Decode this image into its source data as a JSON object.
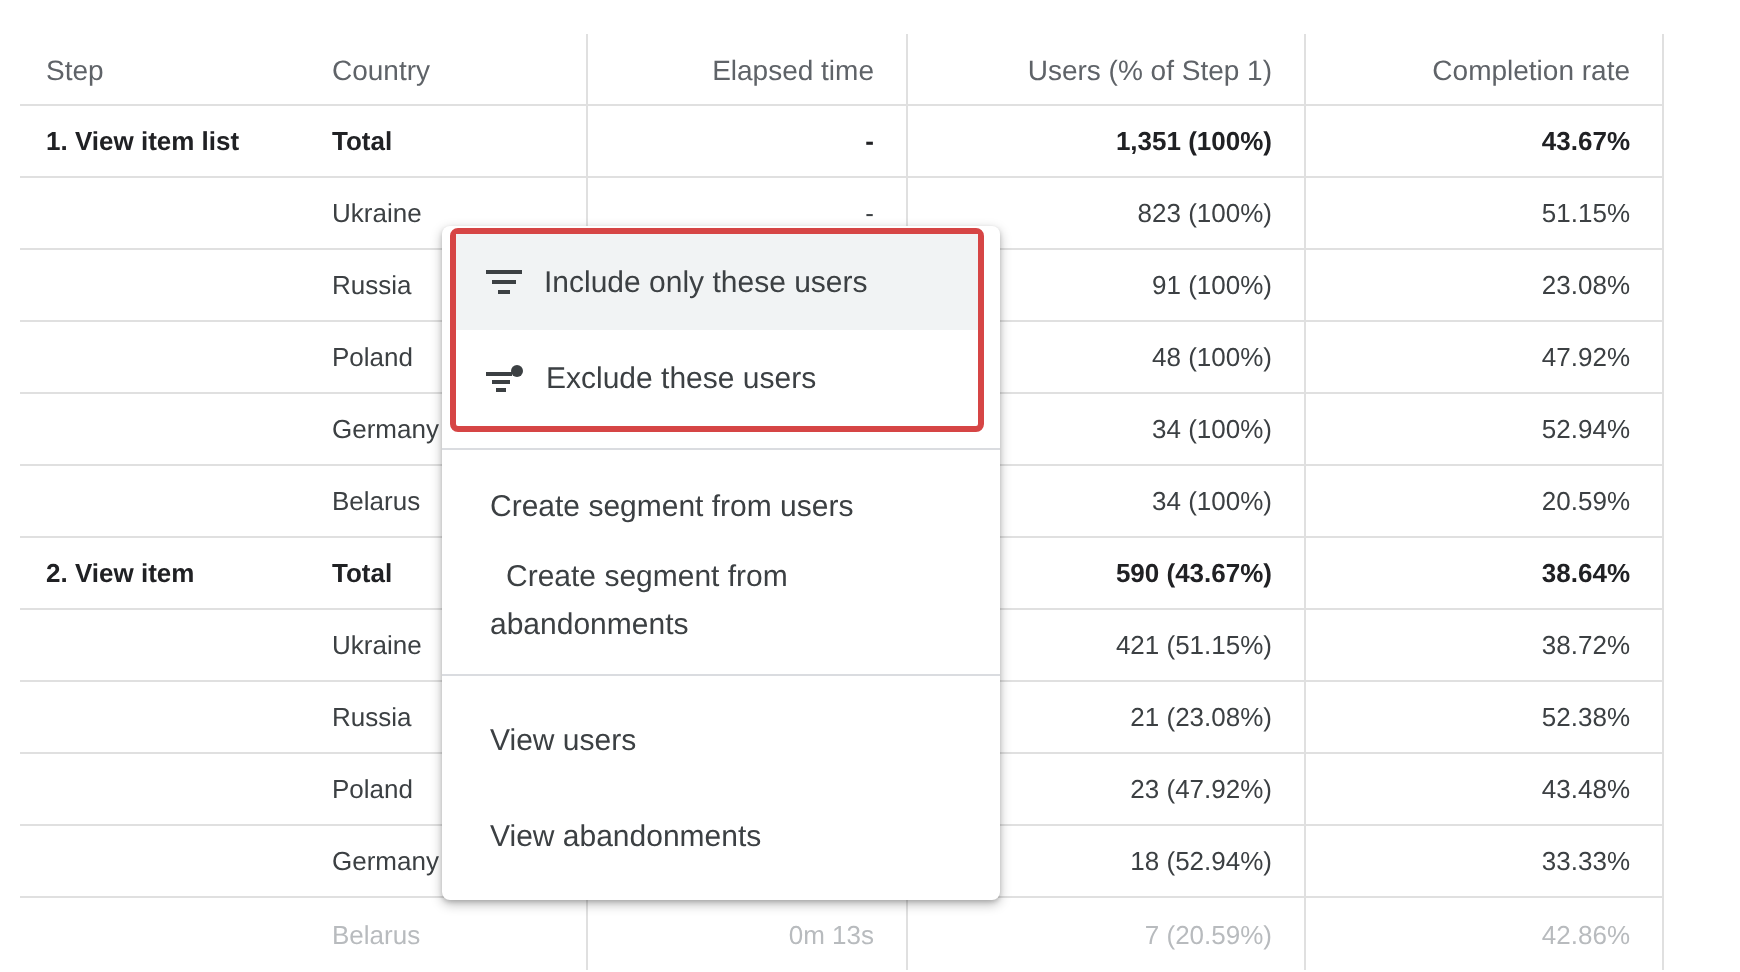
{
  "table": {
    "columns": [
      {
        "label": "Step"
      },
      {
        "label": "Country"
      },
      {
        "label": "Elapsed time"
      },
      {
        "label": "Users (% of Step 1)"
      },
      {
        "label": "Completion rate"
      }
    ],
    "rows": [
      {
        "kind": "total",
        "step": "1. View item list",
        "country": "Total",
        "elapsed": "-",
        "users": "1,351 (100%)",
        "completion": "43.67%"
      },
      {
        "kind": "country",
        "country": "Ukraine",
        "elapsed": "-",
        "users": "823 (100%)",
        "completion": "51.15%"
      },
      {
        "kind": "country",
        "country": "Russia",
        "users": "91 (100%)",
        "completion": "23.08%"
      },
      {
        "kind": "country",
        "country": "Poland",
        "users": "48 (100%)",
        "completion": "47.92%"
      },
      {
        "kind": "country",
        "country": "Germany",
        "users": "34 (100%)",
        "completion": "52.94%"
      },
      {
        "kind": "country",
        "country": "Belarus",
        "users": "34 (100%)",
        "completion": "20.59%"
      },
      {
        "kind": "total",
        "step": "2. View item",
        "country": "Total",
        "users": "590 (43.67%)",
        "completion": "38.64%"
      },
      {
        "kind": "country",
        "country": "Ukraine",
        "users": "421 (51.15%)",
        "completion": "38.72%"
      },
      {
        "kind": "country",
        "country": "Russia",
        "users": "21 (23.08%)",
        "completion": "52.38%"
      },
      {
        "kind": "country",
        "country": "Poland",
        "users": "23 (47.92%)",
        "completion": "43.48%"
      },
      {
        "kind": "country",
        "country": "Germany",
        "users": "18 (52.94%)",
        "completion": "33.33%"
      },
      {
        "kind": "country",
        "country": "Belarus",
        "elapsed": "0m 13s",
        "users": "7 (20.59%)",
        "completion": "42.86%"
      }
    ]
  },
  "context_menu": {
    "sections": [
      {
        "highlighted": true,
        "items": [
          {
            "kind": "include",
            "label": "Include only these users",
            "selected": true
          },
          {
            "kind": "exclude",
            "label": "Exclude these users",
            "selected": false
          }
        ]
      },
      {
        "highlighted": false,
        "items": [
          {
            "kind": "plain",
            "label": "Create segment from users",
            "selected": false
          },
          {
            "kind": "plain",
            "label": "Create segment from abandonments",
            "selected": false
          }
        ]
      },
      {
        "highlighted": false,
        "items": [
          {
            "kind": "plain",
            "label": "View users",
            "selected": false
          },
          {
            "kind": "plain",
            "label": "View abandonments",
            "selected": false
          }
        ]
      }
    ]
  }
}
